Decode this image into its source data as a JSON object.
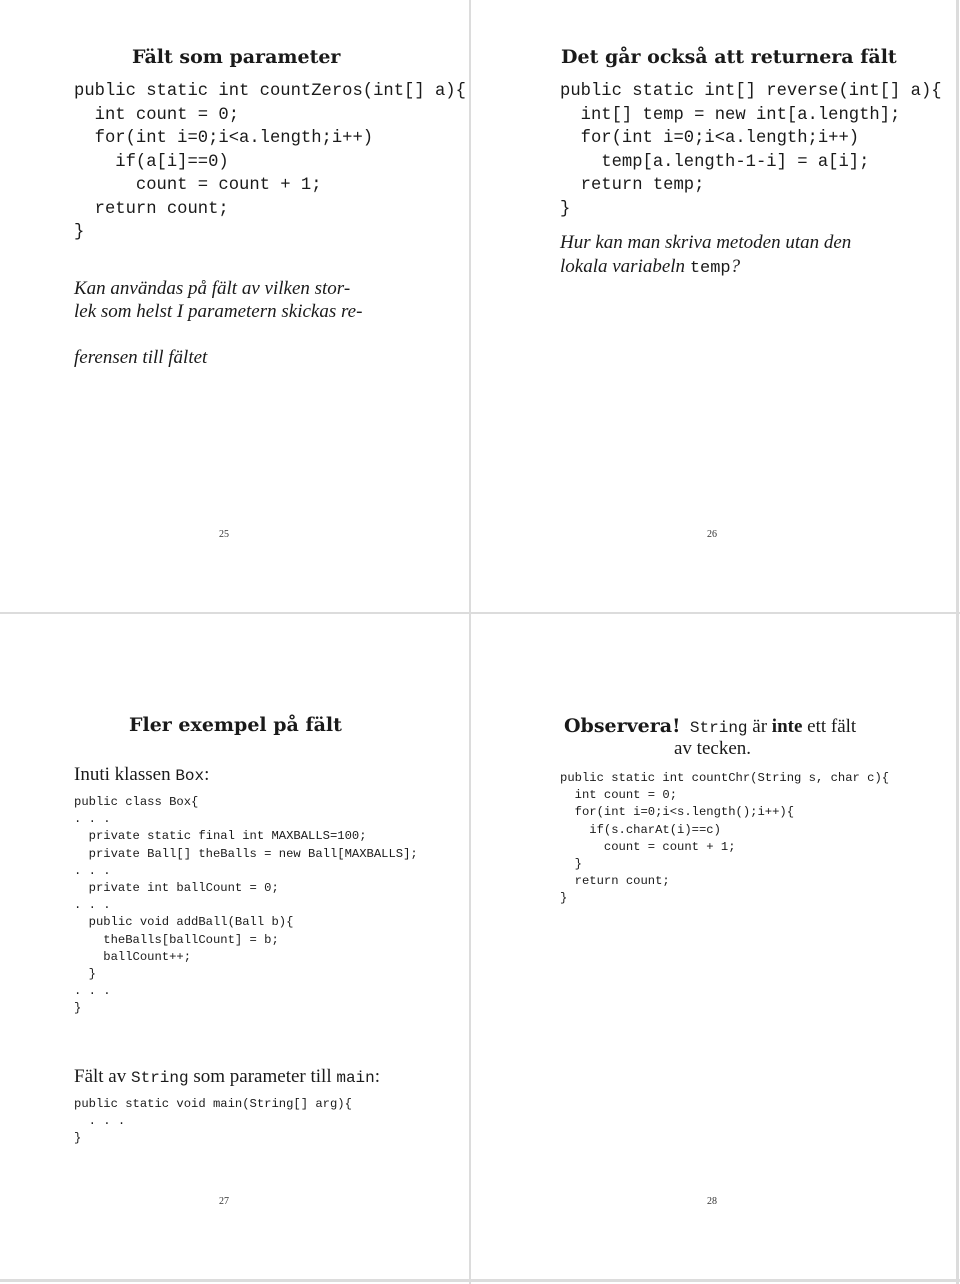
{
  "pages": [
    {
      "number": "25",
      "title": "Fält som parameter",
      "code": "public static int countZeros(int[] a){\n  int count = 0;\n  for(int i=0;i<a.length;i++)\n    if(a[i]==0)\n      count = count + 1;\n  return count;\n}",
      "note_line1": "Kan användas på fält av vilken stor-",
      "note_line2": "lek som helst I parametern skickas re-",
      "note_line3": "ferensen till fältet"
    },
    {
      "number": "26",
      "title": "Det går också att returnera fält",
      "code": "public static int[] reverse(int[] a){\n  int[] temp = new int[a.length];\n  for(int i=0;i<a.length;i++)\n    temp[a.length-1-i] = a[i];\n  return temp;\n}",
      "question_line1": "Hur kan man skriva metoden utan den",
      "question_line2_text": "lokala variabeln ",
      "question_line2_code": "temp",
      "question_line2_end": "?"
    },
    {
      "number": "27",
      "title": "Fler exempel på fält",
      "intro_text": "Inuti klassen ",
      "intro_code": "Box",
      "intro_end": ":",
      "code": "public class Box{\n. . .\n  private static final int MAXBALLS=100;\n  private Ball[] theBalls = new Ball[MAXBALLS];\n. . .\n  private int ballCount = 0;\n. . .\n  public void addBall(Ball b){\n    theBalls[ballCount] = b;\n    ballCount++;\n  }\n. . .\n}",
      "main_text1": "Fält av ",
      "main_code1": "String",
      "main_text2": " som parameter till ",
      "main_code2": "main",
      "main_end": ":",
      "main_code": "public static void main(String[] arg){\n  . . .\n}"
    },
    {
      "number": "28",
      "observe_label": "Observera!",
      "observe_code": "String",
      "observe_text1": " är ",
      "observe_bold": "inte",
      "observe_text2": " ett fält",
      "observe_line2": "av tecken.",
      "code": "public static int countChr(String s, char c){\n  int count = 0;\n  for(int i=0;i<s.length();i++){\n    if(s.charAt(i)==c)\n      count = count + 1;\n  }\n  return count;\n}"
    }
  ]
}
